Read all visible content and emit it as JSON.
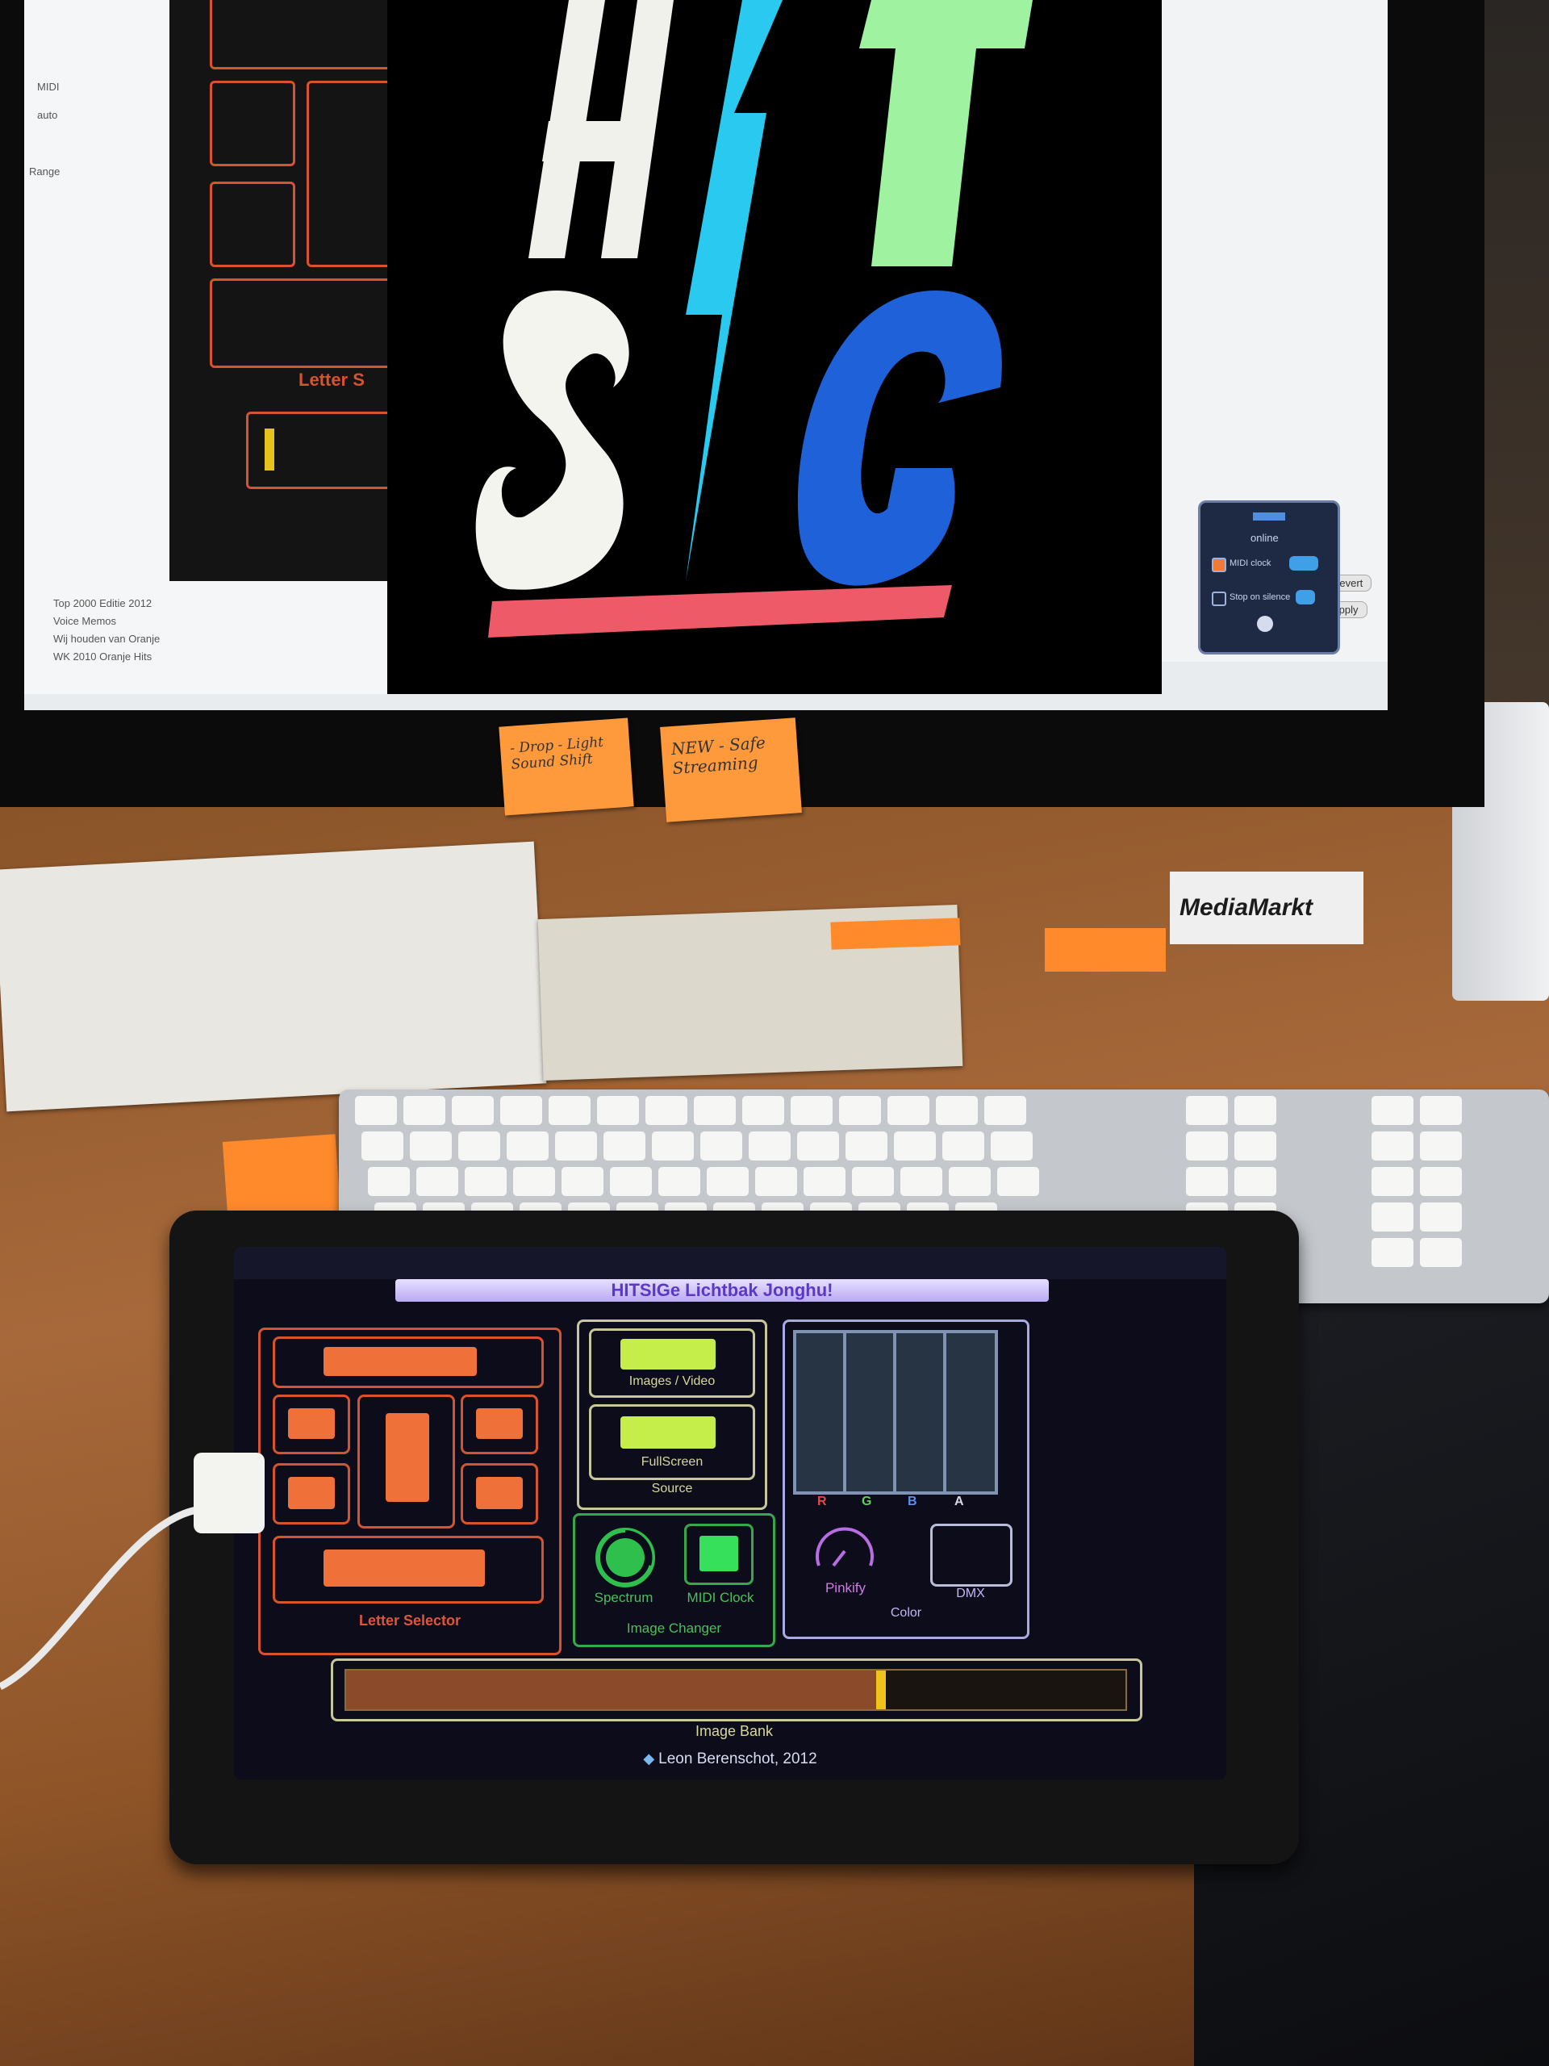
{
  "monitor": {
    "finder_sidebar": [
      "Top 2000 Editie 2012",
      "Voice Memos",
      "Wij houden van Oranje",
      "WK 2010 Oranje Hits"
    ],
    "finder_menu": [
      "MIDI",
      "auto",
      "Range"
    ],
    "bg_app_letter_label": "Letter S",
    "poster_text": "HIT SIG",
    "dark_panel": {
      "status": "online",
      "midi_clock": "MIDI clock",
      "stop_on_silence": "Stop on silence"
    },
    "right_buttons": [
      "Revert",
      "Apply"
    ]
  },
  "sticky_notes": [
    {
      "text": "- Drop - Light Sound Shift"
    },
    {
      "text": "NEW - Safe Streaming"
    }
  ],
  "desk": {
    "media_markt_label": "MediaMarkt"
  },
  "ipad": {
    "app_title": "HITSIGe Lichtbak Jonghu!",
    "groups": {
      "letter_selector": "Letter Selector",
      "source": "Source",
      "source_buttons": [
        "Images / Video",
        "FullScreen"
      ],
      "image_changer": "Image Changer",
      "image_changer_buttons": [
        "Spectrum",
        "MIDI Clock"
      ],
      "color": "Color",
      "color_channels": [
        "R",
        "G",
        "B",
        "A"
      ],
      "color_buttons": [
        "Pinkify",
        "DMX"
      ],
      "image_bank": "Image Bank"
    },
    "image_bank_position": 0.68,
    "credit": "Leon Berenschot, 2012"
  },
  "colors": {
    "accent_orange": "#f0703a",
    "accent_lime": "#c6ee4a",
    "accent_green": "#37a84a",
    "title_purple": "#5b38c8"
  }
}
